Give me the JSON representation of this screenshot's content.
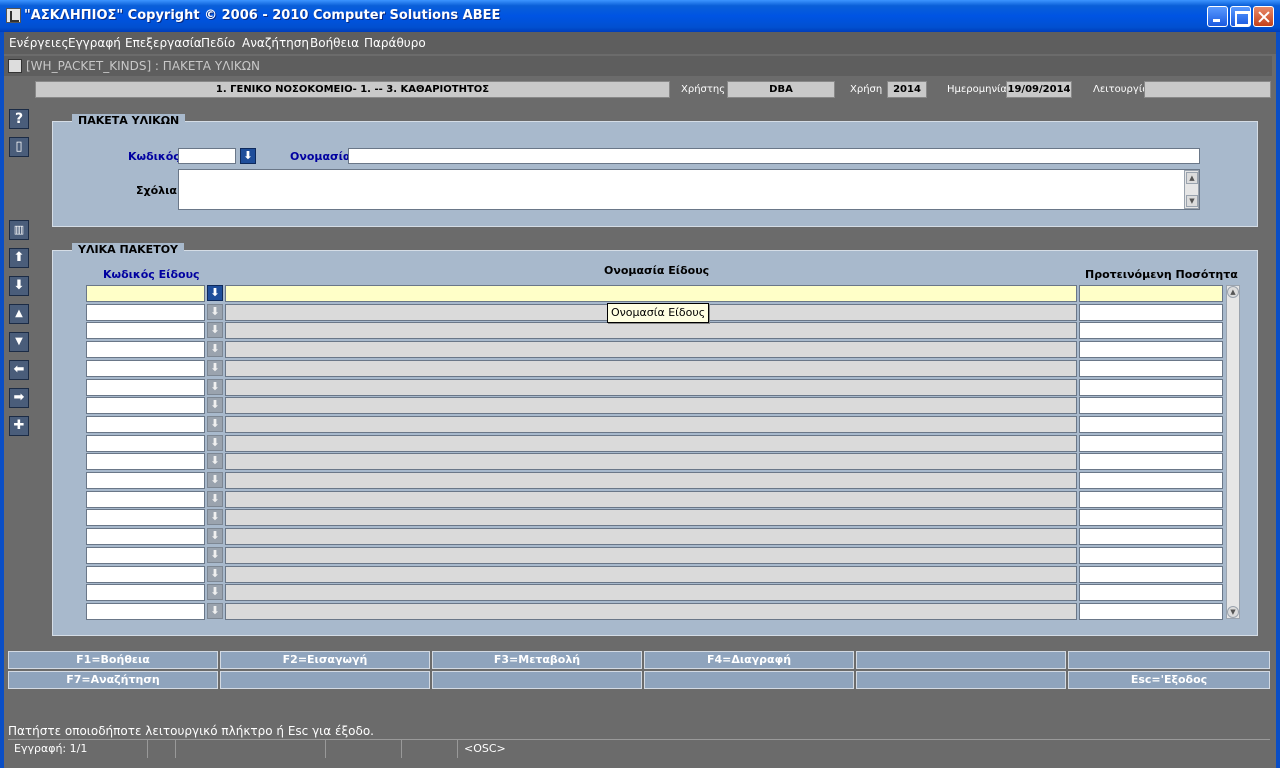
{
  "window": {
    "title": "\"ΑΣΚΛΗΠΙΟΣ\" Copyright © 2006 - 2010 Computer Solutions ABEE"
  },
  "menu": [
    "Ενέργειες",
    "Εγγραφή",
    "Επεξεργασία",
    "Πεδίο",
    "Αναζήτηση",
    "Βοήθεια",
    "Παράθυρο"
  ],
  "form_window": {
    "title": "[WH_PACKET_KINDS]  :  ΠΑΚΕΤΑ ΥΛΙΚΩΝ"
  },
  "header": {
    "organization": "1. ΓΕΝΙΚΟ ΝΟΣΟΚΟΜΕΙΟ- 1. -- 3. ΚΑΘΑΡΙΟΤΗΤΟΣ",
    "user_label": "Χρήστης",
    "user_value": "DBA",
    "year_label": "Χρήση",
    "year_value": "2014",
    "date_label": "Ημερομηνία",
    "date_value": "19/09/2014",
    "mode_label": "Λειτουργία",
    "mode_value": ""
  },
  "left_toolbar": [
    {
      "name": "help-button",
      "glyph": "?"
    },
    {
      "name": "notes-button",
      "glyph": "▯"
    },
    {
      "name": "delete-record-button",
      "glyph": "🗑"
    },
    {
      "name": "first-record-button",
      "glyph": "⤒"
    },
    {
      "name": "last-record-button",
      "glyph": "⤓"
    },
    {
      "name": "previous-record-button",
      "glyph": "▲"
    },
    {
      "name": "next-record-button",
      "glyph": "▼"
    },
    {
      "name": "previous-block-button",
      "glyph": "⇦"
    },
    {
      "name": "next-block-button",
      "glyph": "⇨"
    },
    {
      "name": "insert-record-button",
      "glyph": "✚"
    }
  ],
  "packet_panel": {
    "title": "ΠΑΚΕΤΑ ΥΛΙΚΩΝ",
    "code_label": "Κωδικός",
    "code_value": "",
    "name_label": "Ονομασία",
    "name_value": "",
    "comments_label": "Σχόλια",
    "comments_value": ""
  },
  "materials_panel": {
    "title": "ΥΛΙΚΑ ΠΑΚΕΤΟΥ",
    "columns": {
      "code": "Κωδικός Είδους",
      "name": "Ονομασία Είδους",
      "quantity": "Προτεινόμενη Ποσότητα"
    },
    "row_count": 18,
    "rows": []
  },
  "tooltip": "Ονομασία Είδους",
  "function_keys": {
    "row1": [
      "F1=Βοήθεια",
      "F2=Εισαγωγή",
      "F3=Μεταβολή",
      "F4=Διαγραφή",
      "",
      ""
    ],
    "row2": [
      "F7=Αναζήτηση",
      "",
      "",
      "",
      "",
      "Esc='Εξοδος"
    ]
  },
  "status": {
    "message": "Πατήστε οποιοδήποτε λειτουργικό πλήκτρο ή Esc για έξοδο.",
    "record": "Εγγραφή: 1/1",
    "osc": "<OSC>"
  },
  "colors": {
    "panel_bg": "#a8b9cc",
    "current_row": "#ffffc8",
    "lov_button": "#1f4e9a",
    "label_blue": "#0000a0"
  }
}
